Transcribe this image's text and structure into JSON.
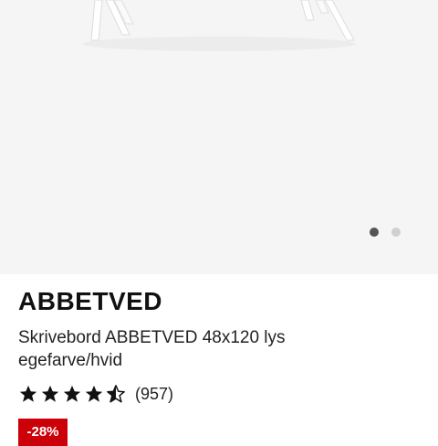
{
  "product": {
    "brand": "ABBETVED",
    "description": "Skrivebord ABBETVED 48x120 lys egefarve/hvid",
    "rating": {
      "value": 4.5,
      "max": 5,
      "count_label": "(957)"
    },
    "discount_badge": "-28%"
  },
  "gallery": {
    "slide_count": 2,
    "active_index": 0
  },
  "colors": {
    "badge": "#cc0008",
    "image_background": "#f5f5f5"
  },
  "icons": {
    "star_full": "star-icon",
    "star_half": "star-half-icon"
  }
}
